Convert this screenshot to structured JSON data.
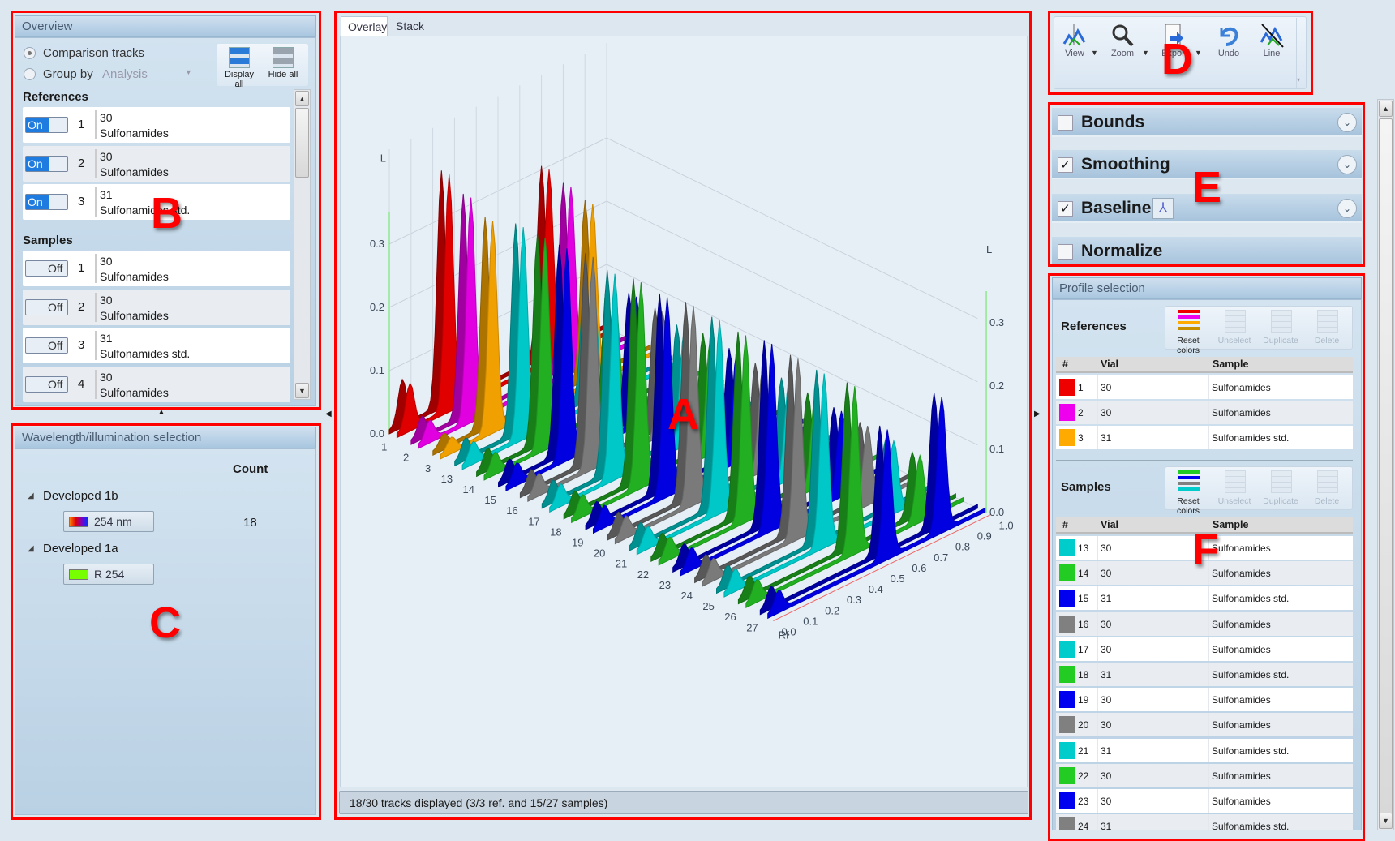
{
  "annotations": {
    "A": "A",
    "B": "B",
    "C": "C",
    "D": "D",
    "E": "E",
    "F": "F"
  },
  "overview": {
    "title": "Overview",
    "radio_comparison": "Comparison tracks",
    "radio_groupby": "Group by",
    "groupby_value": "Analysis",
    "display_all": "Display all",
    "hide_all": "Hide all",
    "references_heading": "References",
    "samples_heading": "Samples",
    "references": [
      {
        "state": "On",
        "num": "1",
        "vial": "30",
        "sample": "Sulfonamides"
      },
      {
        "state": "On",
        "num": "2",
        "vial": "30",
        "sample": "Sulfonamides"
      },
      {
        "state": "On",
        "num": "3",
        "vial": "31",
        "sample": "Sulfonamides std."
      }
    ],
    "samples": [
      {
        "state": "Off",
        "num": "1",
        "vial": "30",
        "sample": "Sulfonamides"
      },
      {
        "state": "Off",
        "num": "2",
        "vial": "30",
        "sample": "Sulfonamides"
      },
      {
        "state": "Off",
        "num": "3",
        "vial": "31",
        "sample": "Sulfonamides std."
      },
      {
        "state": "Off",
        "num": "4",
        "vial": "30",
        "sample": "Sulfonamides"
      }
    ]
  },
  "wavelength": {
    "title": "Wavelength/illumination selection",
    "count_header": "Count",
    "groups": [
      {
        "name": "Developed 1b",
        "button": "254 nm",
        "count": "18",
        "swatch": "gradient"
      },
      {
        "name": "Developed 1a",
        "button": "R 254",
        "count": "",
        "swatch": "#77ff00"
      }
    ]
  },
  "chart_panel": {
    "tabs": [
      "Overlay",
      "Stack"
    ],
    "active_tab": "Overlay",
    "status": "18/30 tracks displayed (3/3 ref. and 15/27 samples)"
  },
  "chart_data": {
    "type": "3d-line",
    "x_axis_label": "Rf",
    "y_axis_label": "L",
    "x_ticks": [
      "0.0",
      "0.1",
      "0.2",
      "0.3",
      "0.4",
      "0.5",
      "0.6",
      "0.7",
      "0.8",
      "0.9",
      "1.0"
    ],
    "y_ticks": [
      "0.0",
      "0.1",
      "0.2",
      "0.3"
    ],
    "xlim": [
      0,
      1
    ],
    "ylim": [
      0,
      0.35
    ],
    "tracks": [
      {
        "label": "1",
        "color": "#e00000",
        "peaks": [
          [
            0.06,
            0.07
          ],
          [
            0.24,
            0.37
          ],
          [
            0.7,
            0.3
          ]
        ]
      },
      {
        "label": "2",
        "color": "#e000e0",
        "peaks": [
          [
            0.05,
            0.03
          ],
          [
            0.24,
            0.35
          ],
          [
            0.7,
            0.29
          ]
        ]
      },
      {
        "label": "3",
        "color": "#f0a000",
        "peaks": [
          [
            0.05,
            0.02
          ],
          [
            0.24,
            0.33
          ],
          [
            0.7,
            0.28
          ]
        ]
      },
      {
        "label": "13",
        "color": "#00c8c8",
        "peaks": [
          [
            0.05,
            0.03
          ],
          [
            0.28,
            0.33
          ],
          [
            0.6,
            0.2
          ]
        ]
      },
      {
        "label": "14",
        "color": "#22b022",
        "peaks": [
          [
            0.05,
            0.03
          ],
          [
            0.28,
            0.33
          ],
          [
            0.6,
            0.2
          ]
        ]
      },
      {
        "label": "15",
        "color": "#0000e0",
        "peaks": [
          [
            0.05,
            0.03
          ],
          [
            0.28,
            0.33
          ],
          [
            0.6,
            0.2
          ]
        ]
      },
      {
        "label": "16",
        "color": "#7a7a7a",
        "peaks": [
          [
            0.05,
            0.03
          ],
          [
            0.3,
            0.33
          ],
          [
            0.62,
            0.19
          ]
        ]
      },
      {
        "label": "17",
        "color": "#00c8c8",
        "peaks": [
          [
            0.05,
            0.03
          ],
          [
            0.3,
            0.32
          ],
          [
            0.62,
            0.18
          ]
        ]
      },
      {
        "label": "18",
        "color": "#22b022",
        "peaks": [
          [
            0.05,
            0.03
          ],
          [
            0.32,
            0.32
          ],
          [
            0.64,
            0.18
          ]
        ]
      },
      {
        "label": "19",
        "color": "#0000e0",
        "peaks": [
          [
            0.05,
            0.03
          ],
          [
            0.34,
            0.31
          ],
          [
            0.66,
            0.17
          ]
        ]
      },
      {
        "label": "20",
        "color": "#7a7a7a",
        "peaks": [
          [
            0.05,
            0.03
          ],
          [
            0.36,
            0.31
          ],
          [
            0.68,
            0.16
          ]
        ]
      },
      {
        "label": "21",
        "color": "#00c8c8",
        "peaks": [
          [
            0.05,
            0.03
          ],
          [
            0.38,
            0.3
          ],
          [
            0.7,
            0.15
          ]
        ]
      },
      {
        "label": "22",
        "color": "#22b022",
        "peaks": [
          [
            0.05,
            0.03
          ],
          [
            0.4,
            0.29
          ],
          [
            0.72,
            0.14
          ]
        ]
      },
      {
        "label": "23",
        "color": "#0000e0",
        "peaks": [
          [
            0.05,
            0.03
          ],
          [
            0.42,
            0.29
          ],
          [
            0.74,
            0.13
          ]
        ]
      },
      {
        "label": "24",
        "color": "#7a7a7a",
        "peaks": [
          [
            0.05,
            0.03
          ],
          [
            0.44,
            0.28
          ],
          [
            0.76,
            0.12
          ]
        ]
      },
      {
        "label": "25",
        "color": "#00c8c8",
        "peaks": [
          [
            0.05,
            0.03
          ],
          [
            0.46,
            0.27
          ],
          [
            0.78,
            0.11
          ]
        ]
      },
      {
        "label": "26",
        "color": "#22b022",
        "peaks": [
          [
            0.05,
            0.03
          ],
          [
            0.5,
            0.26
          ],
          [
            0.8,
            0.1
          ]
        ]
      },
      {
        "label": "27",
        "color": "#0000e0",
        "peaks": [
          [
            0.05,
            0.03
          ],
          [
            0.55,
            0.2
          ],
          [
            0.8,
            0.21
          ]
        ]
      }
    ]
  },
  "toolbar": {
    "view": "View",
    "zoom": "Zoom",
    "export": "Export",
    "undo": "Undo",
    "line": "Line"
  },
  "processing": [
    {
      "label": "Bounds",
      "checked": false,
      "expandable": true
    },
    {
      "label": "Smoothing",
      "checked": true,
      "expandable": true
    },
    {
      "label": "Baseline",
      "checked": true,
      "expandable": true
    },
    {
      "label": "Normalize",
      "checked": false,
      "expandable": false
    }
  ],
  "profile": {
    "title": "Profile selection",
    "references_label": "References",
    "samples_label": "Samples",
    "tools": [
      "Reset colors",
      "Unselect",
      "Duplicate",
      "Delete"
    ],
    "columns": [
      "#",
      "Vial",
      "Sample"
    ],
    "references": [
      {
        "num": "1",
        "vial": "30",
        "sample": "Sulfonamides",
        "color": "#ee0000"
      },
      {
        "num": "2",
        "vial": "30",
        "sample": "Sulfonamides",
        "color": "#ee00ee"
      },
      {
        "num": "3",
        "vial": "31",
        "sample": "Sulfonamides std.",
        "color": "#ffaa00"
      }
    ],
    "samples": [
      {
        "num": "13",
        "vial": "30",
        "sample": "Sulfonamides",
        "color": "#00cccc"
      },
      {
        "num": "14",
        "vial": "30",
        "sample": "Sulfonamides",
        "color": "#22cc22"
      },
      {
        "num": "15",
        "vial": "31",
        "sample": "Sulfonamides std.",
        "color": "#0000ee"
      },
      {
        "num": "16",
        "vial": "30",
        "sample": "Sulfonamides",
        "color": "#808080"
      },
      {
        "num": "17",
        "vial": "30",
        "sample": "Sulfonamides",
        "color": "#00cccc"
      },
      {
        "num": "18",
        "vial": "31",
        "sample": "Sulfonamides std.",
        "color": "#22cc22"
      },
      {
        "num": "19",
        "vial": "30",
        "sample": "Sulfonamides",
        "color": "#0000ee"
      },
      {
        "num": "20",
        "vial": "30",
        "sample": "Sulfonamides",
        "color": "#808080"
      },
      {
        "num": "21",
        "vial": "31",
        "sample": "Sulfonamides std.",
        "color": "#00cccc"
      },
      {
        "num": "22",
        "vial": "30",
        "sample": "Sulfonamides",
        "color": "#22cc22"
      },
      {
        "num": "23",
        "vial": "30",
        "sample": "Sulfonamides",
        "color": "#0000ee"
      },
      {
        "num": "24",
        "vial": "31",
        "sample": "Sulfonamides std.",
        "color": "#808080"
      }
    ]
  }
}
